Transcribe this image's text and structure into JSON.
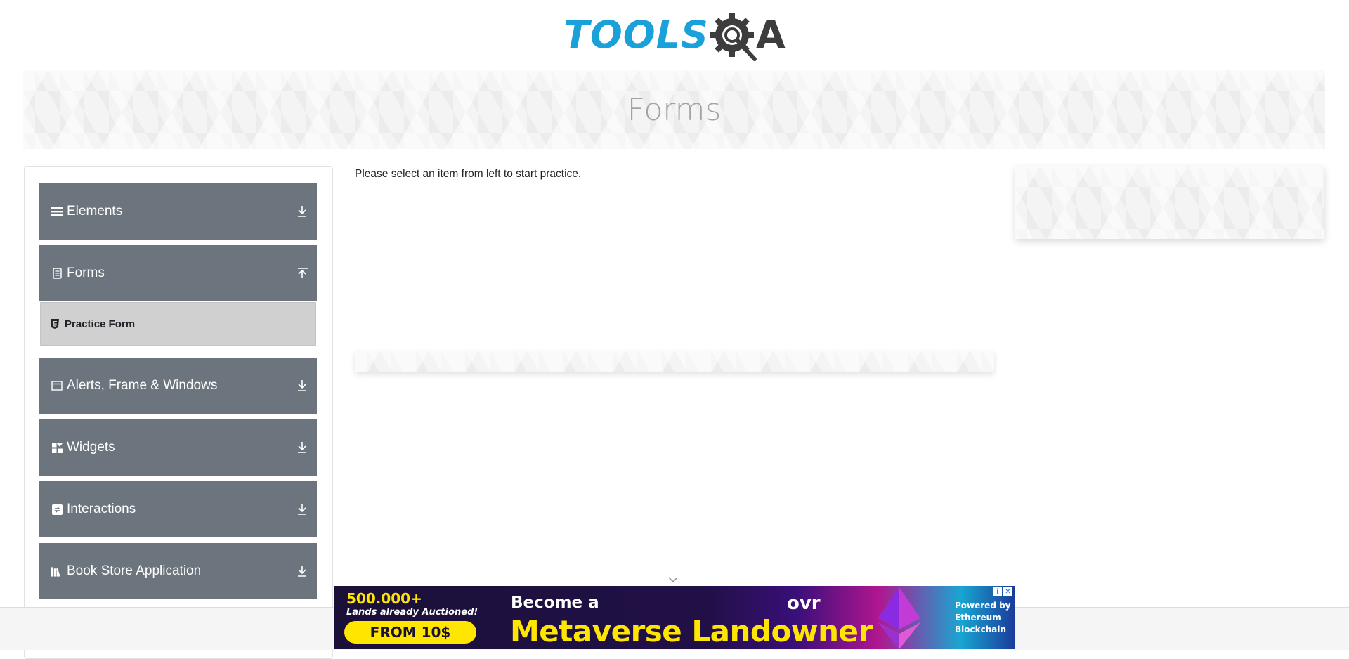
{
  "header": {
    "logo_word": "TOOLS",
    "logo_letter": "A",
    "logo_colors": {
      "primary": "#1aa1d9",
      "secondary": "#3d3d3d"
    }
  },
  "banner": {
    "title": "Forms"
  },
  "sidebar": {
    "groups": [
      {
        "label": "Elements",
        "icon": "hamburger-icon",
        "state": "collapsed"
      },
      {
        "label": "Forms",
        "icon": "document-icon",
        "state": "expanded",
        "items": [
          {
            "label": "Practice Form",
            "icon": "html5-icon"
          }
        ]
      },
      {
        "label": "Alerts, Frame & Windows",
        "icon": "window-icon",
        "state": "collapsed"
      },
      {
        "label": "Widgets",
        "icon": "widgets-icon",
        "state": "collapsed"
      },
      {
        "label": "Interactions",
        "icon": "interactions-icon",
        "state": "collapsed"
      },
      {
        "label": "Book Store Application",
        "icon": "books-icon",
        "state": "collapsed"
      }
    ]
  },
  "main": {
    "intro_text": "Please select an item from left to start practice."
  },
  "ad_bottom": {
    "count": "500.000+",
    "subtitle": "Lands already Auctioned!",
    "cta": "FROM 10$",
    "headline_top": "Become a",
    "headline_main": "Metaverse Landowner",
    "brand": "ovr",
    "powered_lines": [
      "Powered by",
      "Ethereum",
      "Blockchain"
    ],
    "close_glyphs": [
      "i",
      "✕"
    ]
  },
  "colors": {
    "sidebar_group_bg": "#6c757d",
    "active_item_bg": "#d0d0d0",
    "banner_title": "#a3a3a3"
  }
}
